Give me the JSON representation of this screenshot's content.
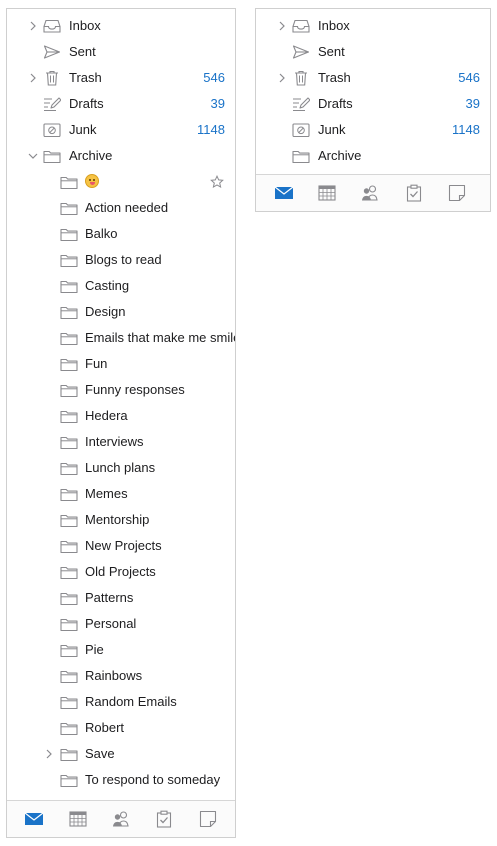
{
  "colors": {
    "accent": "#1a73c8",
    "icon": "#8a8a8e",
    "text": "#1d1d1f",
    "border": "#cfcfcf"
  },
  "left_panel": {
    "folders": [
      {
        "label": "Inbox",
        "count": "",
        "icon": "inbox-icon",
        "chevron": "right"
      },
      {
        "label": "Sent",
        "count": "",
        "icon": "sent-icon",
        "chevron": ""
      },
      {
        "label": "Trash",
        "count": "546",
        "icon": "trash-icon",
        "chevron": "right"
      },
      {
        "label": "Drafts",
        "count": "39",
        "icon": "drafts-icon",
        "chevron": ""
      },
      {
        "label": "Junk",
        "count": "1148",
        "icon": "junk-icon",
        "chevron": ""
      },
      {
        "label": "Archive",
        "count": "",
        "icon": "folder-icon",
        "chevron": "down"
      }
    ],
    "subfolders": [
      {
        "label": "",
        "emoji": "face-with-tongue",
        "star": true
      },
      {
        "label": "Action needed"
      },
      {
        "label": "Balko"
      },
      {
        "label": "Blogs to read"
      },
      {
        "label": "Casting"
      },
      {
        "label": "Design"
      },
      {
        "label": "Emails that make me smile"
      },
      {
        "label": "Fun"
      },
      {
        "label": "Funny responses"
      },
      {
        "label": "Hedera"
      },
      {
        "label": "Interviews"
      },
      {
        "label": "Lunch plans"
      },
      {
        "label": "Memes"
      },
      {
        "label": "Mentorship"
      },
      {
        "label": "New Projects"
      },
      {
        "label": "Old Projects"
      },
      {
        "label": "Patterns"
      },
      {
        "label": "Personal"
      },
      {
        "label": "Pie"
      },
      {
        "label": "Rainbows"
      },
      {
        "label": "Random Emails"
      },
      {
        "label": "Robert"
      },
      {
        "label": "Save",
        "chevron": "right"
      },
      {
        "label": "To respond to someday"
      }
    ]
  },
  "right_panel": {
    "folders": [
      {
        "label": "Inbox",
        "count": "",
        "icon": "inbox-icon",
        "chevron": "right"
      },
      {
        "label": "Sent",
        "count": "",
        "icon": "sent-icon",
        "chevron": ""
      },
      {
        "label": "Trash",
        "count": "546",
        "icon": "trash-icon",
        "chevron": "right"
      },
      {
        "label": "Drafts",
        "count": "39",
        "icon": "drafts-icon",
        "chevron": ""
      },
      {
        "label": "Junk",
        "count": "1148",
        "icon": "junk-icon",
        "chevron": ""
      },
      {
        "label": "Archive",
        "count": "",
        "icon": "folder-icon",
        "chevron": ""
      }
    ]
  },
  "bottom_tabs": [
    {
      "icon": "mail-icon",
      "active": true
    },
    {
      "icon": "calendar-icon",
      "active": false
    },
    {
      "icon": "people-icon",
      "active": false
    },
    {
      "icon": "tasks-icon",
      "active": false
    },
    {
      "icon": "notes-icon",
      "active": false
    }
  ]
}
